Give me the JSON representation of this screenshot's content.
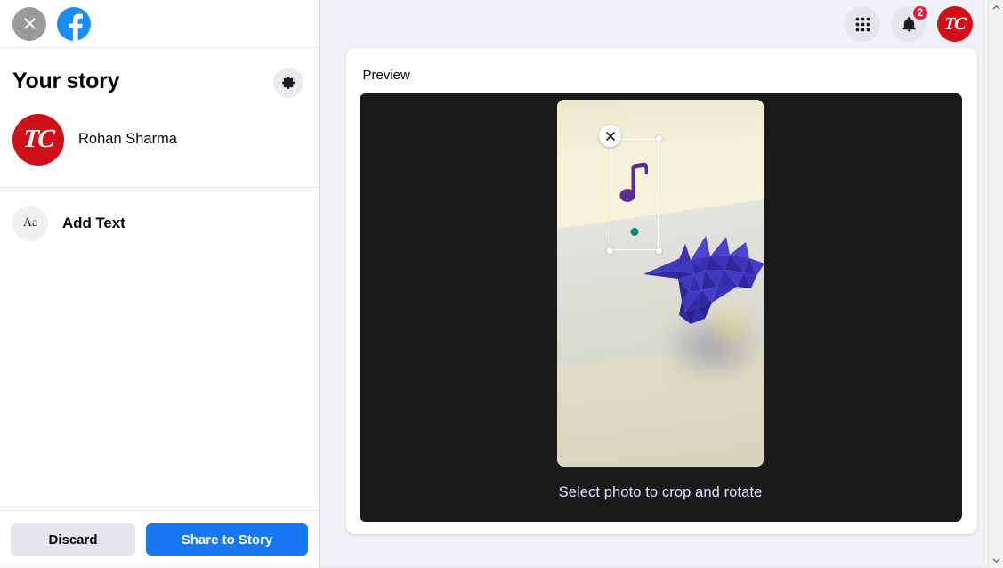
{
  "sidebar": {
    "topbar": {
      "close_icon": "close-x-icon",
      "brand_icon": "facebook-logo-icon",
      "close_label": "Close"
    },
    "story_title": "Your story",
    "settings_icon": "gear-icon",
    "profile": {
      "avatar_text": "TC",
      "avatar_icon": "tc-avatar-icon",
      "name": "Rohan Sharma"
    },
    "tools": [
      {
        "icon_label": "Aa",
        "icon_name": "text-tool-icon",
        "label": "Add Text"
      }
    ],
    "footer": {
      "discard_label": "Discard",
      "share_label": "Share to Story"
    }
  },
  "topbar": {
    "menu_icon": "grid-menu-icon",
    "notifications_icon": "bell-icon",
    "notifications_count": "2",
    "account_avatar_text": "TC",
    "account_avatar_icon": "tc-avatar-icon"
  },
  "main": {
    "preview_label": "Preview",
    "stage_caption": "Select photo to crop and rotate",
    "sticker": {
      "type": "music-note-sticker",
      "close_icon": "sticker-close-icon",
      "rotate_handle": "rotate-handle",
      "resize_handle": "resize-handle"
    },
    "photo": {
      "alt_name": "origami-sculpture-photo"
    }
  },
  "scrollbar": {
    "up_icon": "chevron-up-icon",
    "down_icon": "chevron-down-icon"
  },
  "colors": {
    "brand_blue": "#1877f2",
    "fb_logo_blue": "#1b8cf2",
    "badge_red": "#e41e3f",
    "avatar_red": "#cf1019",
    "stage_dark": "#1a1a1c",
    "page_bg": "#f0f2f5",
    "sticker_purple": "#5b2d99",
    "handle_teal": "#0a8a74",
    "origami_blue": "#3b32b8"
  }
}
